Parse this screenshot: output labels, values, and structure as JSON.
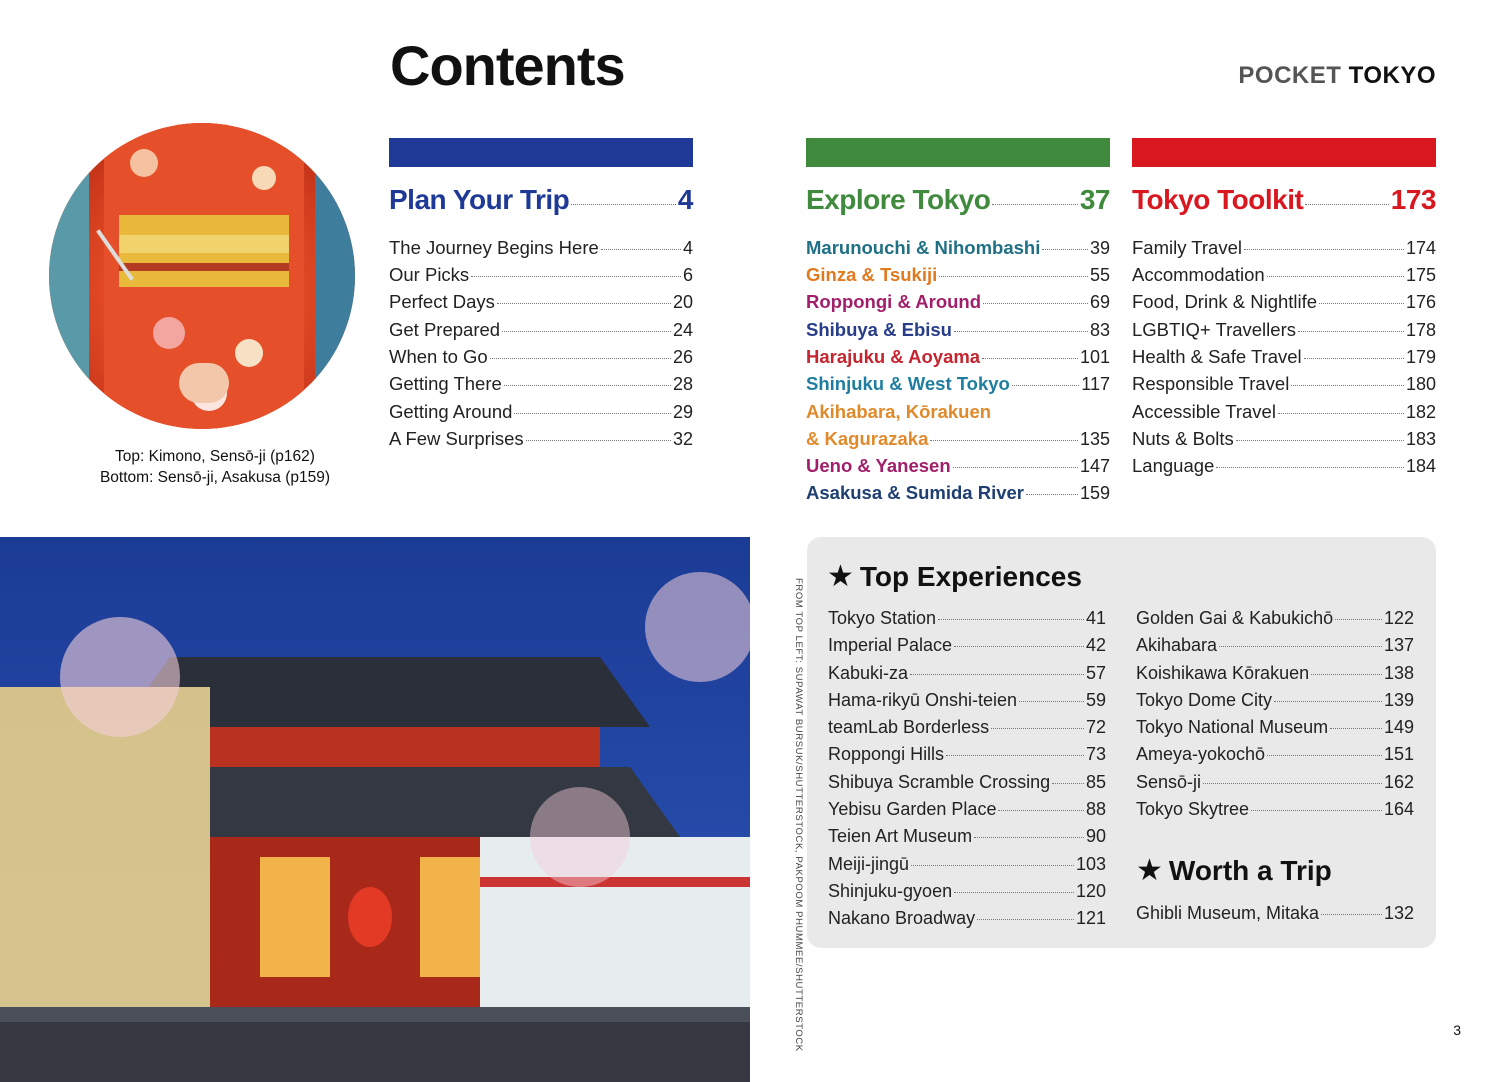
{
  "header": {
    "title": "Contents",
    "brand_light": "POCKET",
    "brand_bold": "TOKYO"
  },
  "colors": {
    "plan": "#1e3a96",
    "explore": "#3f8a3c",
    "toolkit": "#d8171f",
    "panel": "#e9e9ea"
  },
  "plan": {
    "title": "Plan Your Trip",
    "page": "4",
    "items": [
      {
        "label": "The Journey Begins Here",
        "page": "4"
      },
      {
        "label": "Our Picks",
        "page": "6"
      },
      {
        "label": "Perfect Days",
        "page": "20"
      },
      {
        "label": "Get Prepared",
        "page": "24"
      },
      {
        "label": "When to Go",
        "page": "26"
      },
      {
        "label": "Getting There",
        "page": "28"
      },
      {
        "label": "Getting Around",
        "page": "29"
      },
      {
        "label": "A Few Surprises",
        "page": "32"
      }
    ]
  },
  "explore": {
    "title": "Explore Tokyo",
    "page": "37",
    "items": [
      {
        "label": "Marunouchi & Nihombashi",
        "page": "39",
        "color": "#1f6f85"
      },
      {
        "label": "Ginza & Tsukiji",
        "page": "55",
        "color": "#e07a1f"
      },
      {
        "label": "Roppongi & Around",
        "page": "69",
        "color": "#a11f6a"
      },
      {
        "label": "Shibuya & Ebisu",
        "page": "83",
        "color": "#283d8a"
      },
      {
        "label": "Harajuku & Aoyama",
        "page": "101",
        "color": "#c4252f"
      },
      {
        "label": "Shinjuku & West Tokyo",
        "page": "117",
        "color": "#1f7ea0"
      },
      {
        "label": "Akihabara, Kōrakuen",
        "page": "",
        "color": "#e08a2b"
      },
      {
        "label": "& Kagurazaka",
        "page": "135",
        "color": "#e08a2b"
      },
      {
        "label": "Ueno & Yanesen",
        "page": "147",
        "color": "#a11f6a"
      },
      {
        "label": "Asakusa & Sumida River",
        "page": "159",
        "color": "#1f3f73"
      }
    ]
  },
  "toolkit": {
    "title": "Tokyo Toolkit",
    "page": "173",
    "items": [
      {
        "label": "Family Travel",
        "page": "174"
      },
      {
        "label": "Accommodation",
        "page": "175"
      },
      {
        "label": "Food, Drink & Nightlife",
        "page": "176"
      },
      {
        "label": "LGBTIQ+ Travellers",
        "page": "178"
      },
      {
        "label": "Health & Safe Travel",
        "page": "179"
      },
      {
        "label": "Responsible Travel",
        "page": "180"
      },
      {
        "label": "Accessible Travel",
        "page": "182"
      },
      {
        "label": "Nuts & Bolts",
        "page": "183"
      },
      {
        "label": "Language",
        "page": "184"
      }
    ]
  },
  "caption": {
    "line1": "Top: Kimono, Sensō-ji (p162)",
    "line2": "Bottom: Sensō-ji, Asakusa (p159)"
  },
  "credit": "FROM TOP LEFT: SUPAWAT BURSUK/SHUTTERSTOCK, PAKPOOM PHUMMEE/SHUTTERSTOCK",
  "top_experiences": {
    "title": "Top Experiences",
    "left": [
      {
        "label": "Tokyo Station",
        "page": "41"
      },
      {
        "label": "Imperial Palace",
        "page": "42"
      },
      {
        "label": "Kabuki-za",
        "page": "57"
      },
      {
        "label": "Hama-rikyū Onshi-teien",
        "page": "59"
      },
      {
        "label": "teamLab Borderless",
        "page": "72"
      },
      {
        "label": "Roppongi Hills",
        "page": "73"
      },
      {
        "label": "Shibuya Scramble Crossing",
        "page": "85"
      },
      {
        "label": "Yebisu Garden Place",
        "page": "88"
      },
      {
        "label": "Teien Art Museum",
        "page": "90"
      },
      {
        "label": "Meiji-jingū",
        "page": "103"
      },
      {
        "label": "Shinjuku-gyoen",
        "page": "120"
      },
      {
        "label": "Nakano Broadway",
        "page": "121"
      }
    ],
    "right": [
      {
        "label": "Golden Gai & Kabukichō",
        "page": "122"
      },
      {
        "label": "Akihabara",
        "page": "137"
      },
      {
        "label": "Koishikawa Kōrakuen",
        "page": "138"
      },
      {
        "label": "Tokyo Dome City",
        "page": "139"
      },
      {
        "label": "Tokyo National Museum",
        "page": "149"
      },
      {
        "label": "Ameya-yokochō",
        "page": "151"
      },
      {
        "label": "Sensō-ji",
        "page": "162"
      },
      {
        "label": "Tokyo Skytree",
        "page": "164"
      }
    ]
  },
  "worth_a_trip": {
    "title": "Worth a Trip",
    "items": [
      {
        "label": "Ghibli Museum, Mitaka",
        "page": "132"
      }
    ]
  },
  "page_number": "3"
}
